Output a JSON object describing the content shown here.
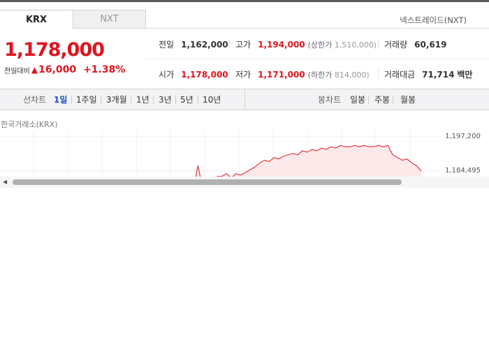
{
  "tabs": {
    "krx": "KRX",
    "nxt": "NXT"
  },
  "nxt_link": "넥스트레이드(NXT)",
  "price": {
    "current": "1,178,000",
    "change_label": "전일대비",
    "change_arrow": "▲",
    "change_value": "16,000",
    "change_pct": "+1.38%",
    "color": "#e0141e"
  },
  "info": {
    "prev_label": "전일",
    "prev_value": "1,162,000",
    "high_label": "고가",
    "high_value": "1,194,000",
    "upper_label": "(상한가",
    "upper_value": "1,510,000)",
    "volume_label": "거래량",
    "volume_value": "60,619",
    "open_label": "시가",
    "open_value": "1,178,000",
    "low_label": "저가",
    "low_value": "1,171,000",
    "lower_label": "(하한가",
    "lower_value": "814,000)",
    "amount_label": "거래대금",
    "amount_value": "71,714",
    "amount_unit": "백만"
  },
  "periods": {
    "line_label": "선차트",
    "items": [
      "1일",
      "1주일",
      "3개월",
      "1년",
      "3년",
      "5년",
      "10년"
    ],
    "active": "1일",
    "candle_label": "봉차트",
    "candle_items": [
      "일봉",
      "주봉",
      "월봉"
    ]
  },
  "chart": {
    "exchange_label": "한국거래소(KRX)",
    "y_ticks": [
      "1,197,200",
      "1,184,495"
    ],
    "accent": "#e0141e",
    "fill": "#fde3e3"
  },
  "chart_data": {
    "type": "area",
    "y_ticks": [
      1197200,
      1184495
    ],
    "ylim": [
      1173000,
      1197200
    ],
    "x": [
      0,
      1,
      2,
      3,
      4,
      5,
      6,
      7,
      8,
      9,
      10,
      11,
      12,
      13,
      14,
      15,
      16,
      17,
      18,
      19,
      20,
      21,
      22,
      23,
      24,
      25,
      26,
      27,
      28,
      29,
      30,
      31,
      32,
      33,
      34,
      35,
      36,
      37,
      38,
      39,
      40,
      41,
      42,
      43,
      44,
      45,
      46,
      47,
      48,
      49,
      50,
      51,
      52,
      53,
      54,
      55,
      56,
      57,
      58,
      59,
      60
    ],
    "values": [
      1178000,
      1178000,
      1178000,
      1178000,
      1178000,
      1178000,
      1178000,
      1178000,
      1178000,
      1178000,
      1178000,
      1178000,
      1178000,
      1186500,
      1178000,
      1181000,
      1181500,
      1182500,
      1182500,
      1183500,
      1182000,
      1183500,
      1183000,
      1184000,
      1185000,
      1186000,
      1187500,
      1188500,
      1188000,
      1189500,
      1189000,
      1190000,
      1190500,
      1191000,
      1190500,
      1192000,
      1191500,
      1192500,
      1192000,
      1193000,
      1192500,
      1193500,
      1193000,
      1194000,
      1193500,
      1193500,
      1194000,
      1193500,
      1194000,
      1193500,
      1193500,
      1194000,
      1193500,
      1194000,
      1190500,
      1189500,
      1188500,
      1189000,
      1187500,
      1186500,
      1184500
    ]
  }
}
